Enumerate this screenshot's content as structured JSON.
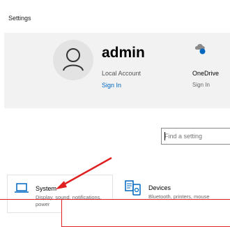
{
  "window": {
    "title": "Settings"
  },
  "account": {
    "name": "admin",
    "type": "Local Account",
    "sign_in_label": "Sign In"
  },
  "onedrive": {
    "label": "OneDrive",
    "status": "Sign In"
  },
  "search": {
    "placeholder": "Find a setting",
    "value": ""
  },
  "tiles": [
    {
      "title": "System",
      "description": "Display, sound, notifications, power",
      "icon": "laptop-icon"
    },
    {
      "title": "Devices",
      "description": "Bluetooth, printers, mouse",
      "icon": "devices-icon"
    }
  ],
  "colors": {
    "accent": "#0067c0",
    "annotation": "#e02020",
    "header_band": "#f2f2f2"
  }
}
